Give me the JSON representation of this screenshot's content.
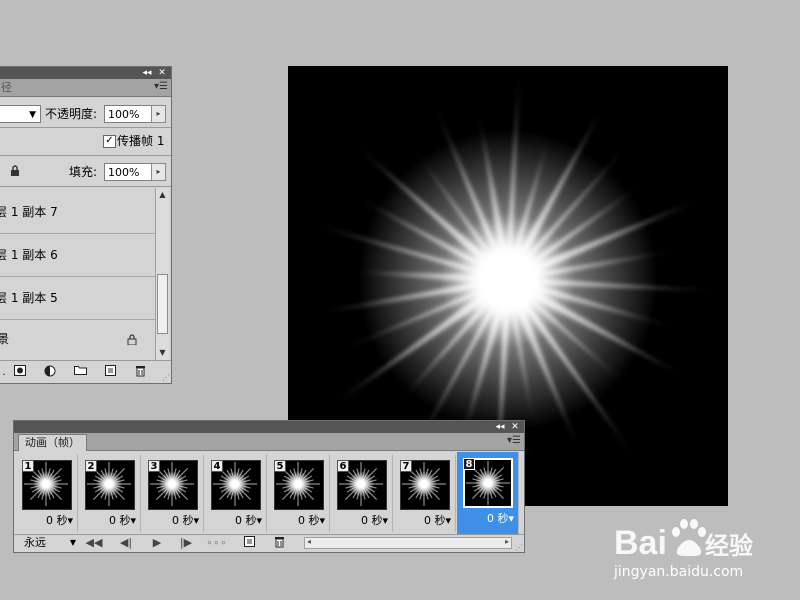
{
  "layers_panel": {
    "title_controls": {
      "collapse": "◂◂",
      "close": "✕"
    },
    "tab_label": "径",
    "opacity_label": "不透明度:",
    "opacity_value": "100%",
    "propagate_label": "传播帧 1",
    "propagate_checked": true,
    "fill_label": "填充:",
    "fill_value": "100%",
    "layers": [
      {
        "name": "层 1 副本 7"
      },
      {
        "name": "层 1 副本 6"
      },
      {
        "name": "层 1 副本 5"
      },
      {
        "name": "背景",
        "locked": true
      }
    ]
  },
  "animation_panel": {
    "title_controls": {
      "collapse": "◂◂",
      "close": "✕"
    },
    "tab_label": "动画（帧）",
    "frames": [
      {
        "number": "1",
        "delay": "0 秒",
        "selected": false
      },
      {
        "number": "2",
        "delay": "0 秒",
        "selected": false
      },
      {
        "number": "3",
        "delay": "0 秒",
        "selected": false
      },
      {
        "number": "4",
        "delay": "0 秒",
        "selected": false
      },
      {
        "number": "5",
        "delay": "0 秒",
        "selected": false
      },
      {
        "number": "6",
        "delay": "0 秒",
        "selected": false
      },
      {
        "number": "7",
        "delay": "0 秒",
        "selected": false
      },
      {
        "number": "8",
        "delay": "0 秒",
        "selected": true
      }
    ],
    "loop_option": "永远"
  },
  "watermark": {
    "brand": "Baidu 经验",
    "url": "jingyan.baidu.com"
  },
  "colors": {
    "selection": "#3d8fe8",
    "panel_bg": "#d4d4d4",
    "workspace_bg": "#bdbdbd"
  }
}
